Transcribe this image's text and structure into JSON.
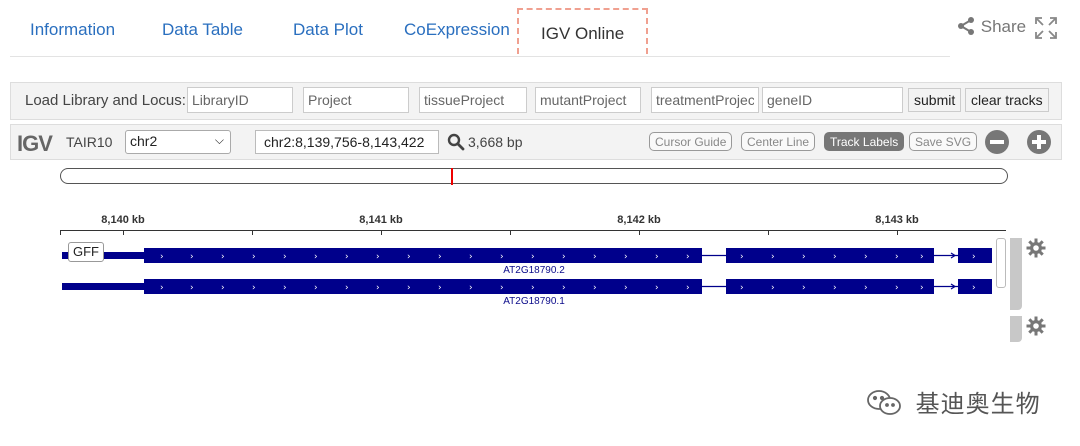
{
  "tabs": [
    {
      "label": "Information"
    },
    {
      "label": "Data Table"
    },
    {
      "label": "Data Plot"
    },
    {
      "label": "CoExpression"
    },
    {
      "label": "IGV Online"
    }
  ],
  "header": {
    "share_label": "Share"
  },
  "loadbar": {
    "label": "Load Library and Locus:",
    "placeholders": [
      "LibraryID",
      "Project",
      "tissueProject",
      "mutantProject",
      "treatmentProject",
      "geneID"
    ],
    "submit_label": "submit",
    "clear_label": "clear tracks"
  },
  "igv": {
    "logo": "IGV",
    "genome": "TAIR10",
    "chromosome": "chr2",
    "locus": "chr2:8,139,756-8,143,422",
    "bp_width": "3,668 bp",
    "buttons": [
      "Cursor Guide",
      "Center Line",
      "Track Labels",
      "Save SVG"
    ],
    "active_button": "Track Labels"
  },
  "ruler": {
    "ticks": [
      "8,140 kb",
      "8,141 kb",
      "8,142 kb",
      "8,143 kb"
    ]
  },
  "track": {
    "name": "GFF",
    "transcripts": [
      "AT2G18790.2",
      "AT2G18790.1"
    ],
    "feature_color": "#00008b"
  },
  "watermark": {
    "text": "基迪奥生物"
  }
}
